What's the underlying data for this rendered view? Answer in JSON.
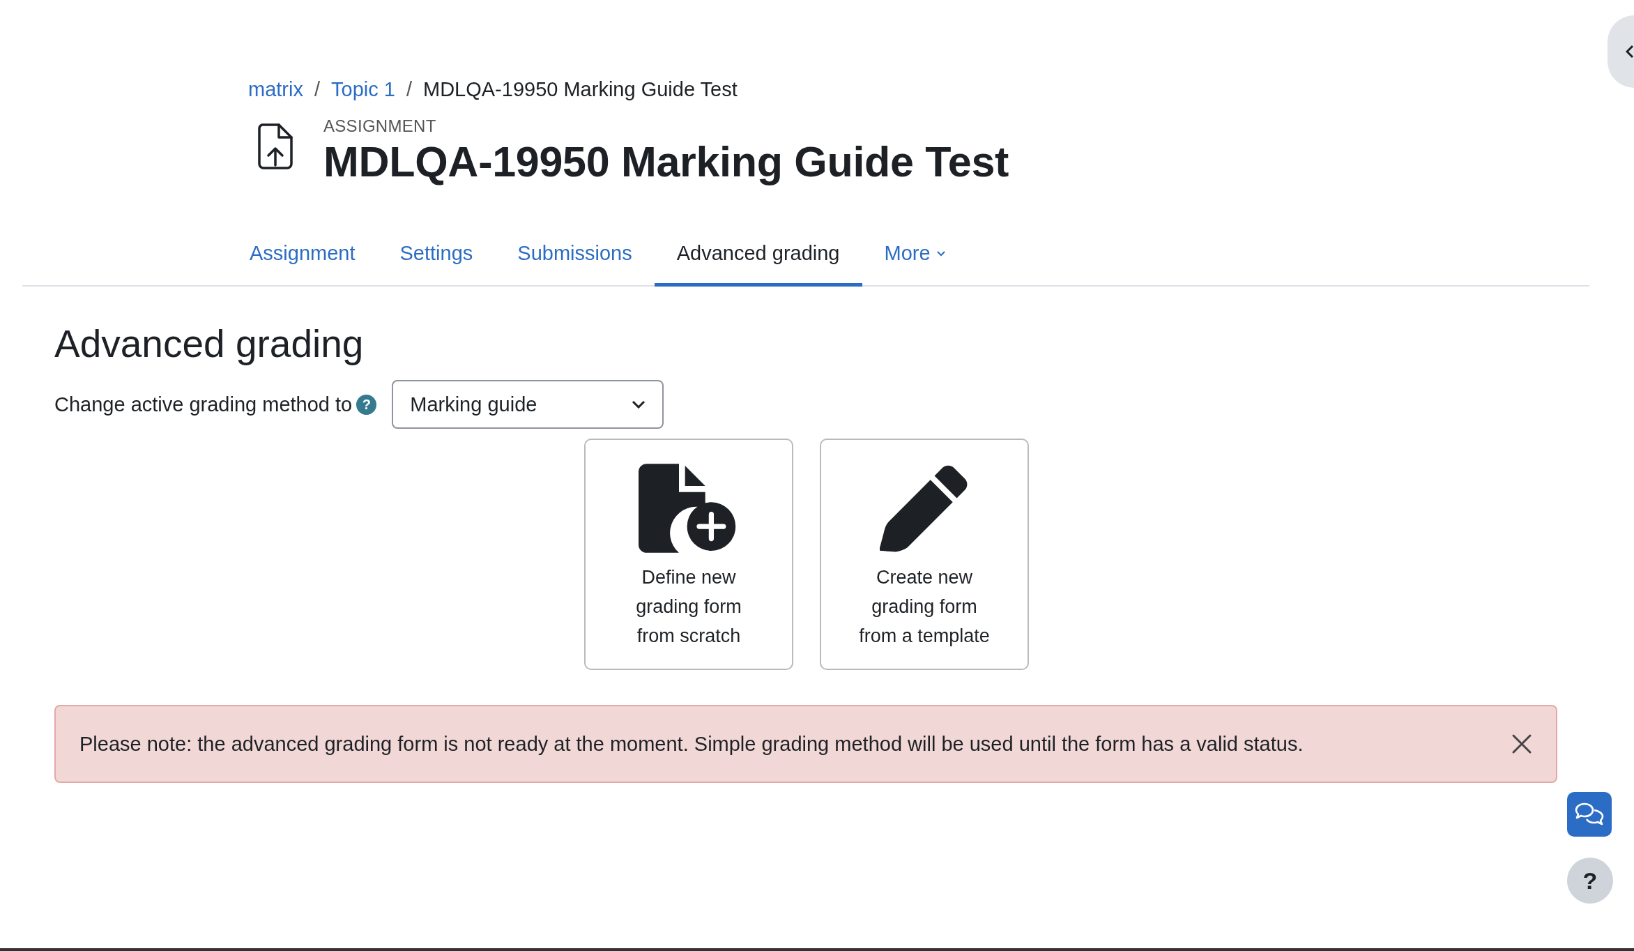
{
  "breadcrumb": [
    {
      "label": "matrix",
      "link": true
    },
    {
      "label": "Topic 1",
      "link": true,
      "separator": "/"
    },
    {
      "label": "MDLQA-19950 Marking Guide Test",
      "link": false,
      "separator": "/"
    }
  ],
  "activity": {
    "type_label": "ASSIGNMENT",
    "title": "MDLQA-19950 Marking Guide Test"
  },
  "tabs": [
    {
      "label": "Assignment",
      "selected": false,
      "menu": false
    },
    {
      "label": "Settings",
      "selected": false,
      "menu": false
    },
    {
      "label": "Submissions",
      "selected": false,
      "menu": false
    },
    {
      "label": "Advanced grading",
      "selected": true,
      "menu": false
    },
    {
      "label": "More",
      "selected": false,
      "menu": true
    }
  ],
  "page": {
    "heading": "Advanced grading",
    "method_label": "Change active grading method to",
    "method_help": "?",
    "method_value": "Marking guide"
  },
  "actions": [
    {
      "kind": "new",
      "label": "Define new grading form from scratch"
    },
    {
      "kind": "template",
      "label": "Create new grading form from a template"
    }
  ],
  "alert": {
    "text": "Please note: the advanced grading form is not ready at the moment. Simple grading method will be used until the form has a valid status.",
    "dismissible": true
  },
  "help_button": {
    "label": "?"
  }
}
